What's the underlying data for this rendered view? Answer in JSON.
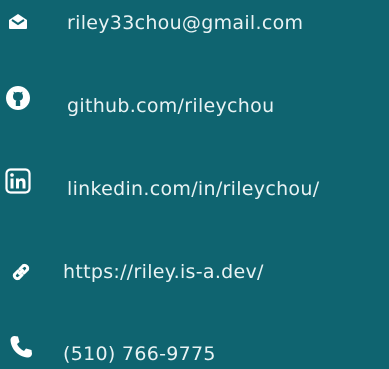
{
  "contacts": {
    "email": {
      "icon": "envelope-icon",
      "label": "riley33chou@gmail.com"
    },
    "github": {
      "icon": "github-icon",
      "label": "github.com/rileychou"
    },
    "linkedin": {
      "icon": "linkedin-icon",
      "label": "linkedin.com/in/rileychou/"
    },
    "website": {
      "icon": "link-icon",
      "label": "https://riley.is-a.dev/"
    },
    "phone": {
      "icon": "phone-icon",
      "label": "(510) 766-9775"
    }
  },
  "colors": {
    "background": "#0f6470",
    "text": "#e9f3f4",
    "icon": "#ffffff"
  }
}
